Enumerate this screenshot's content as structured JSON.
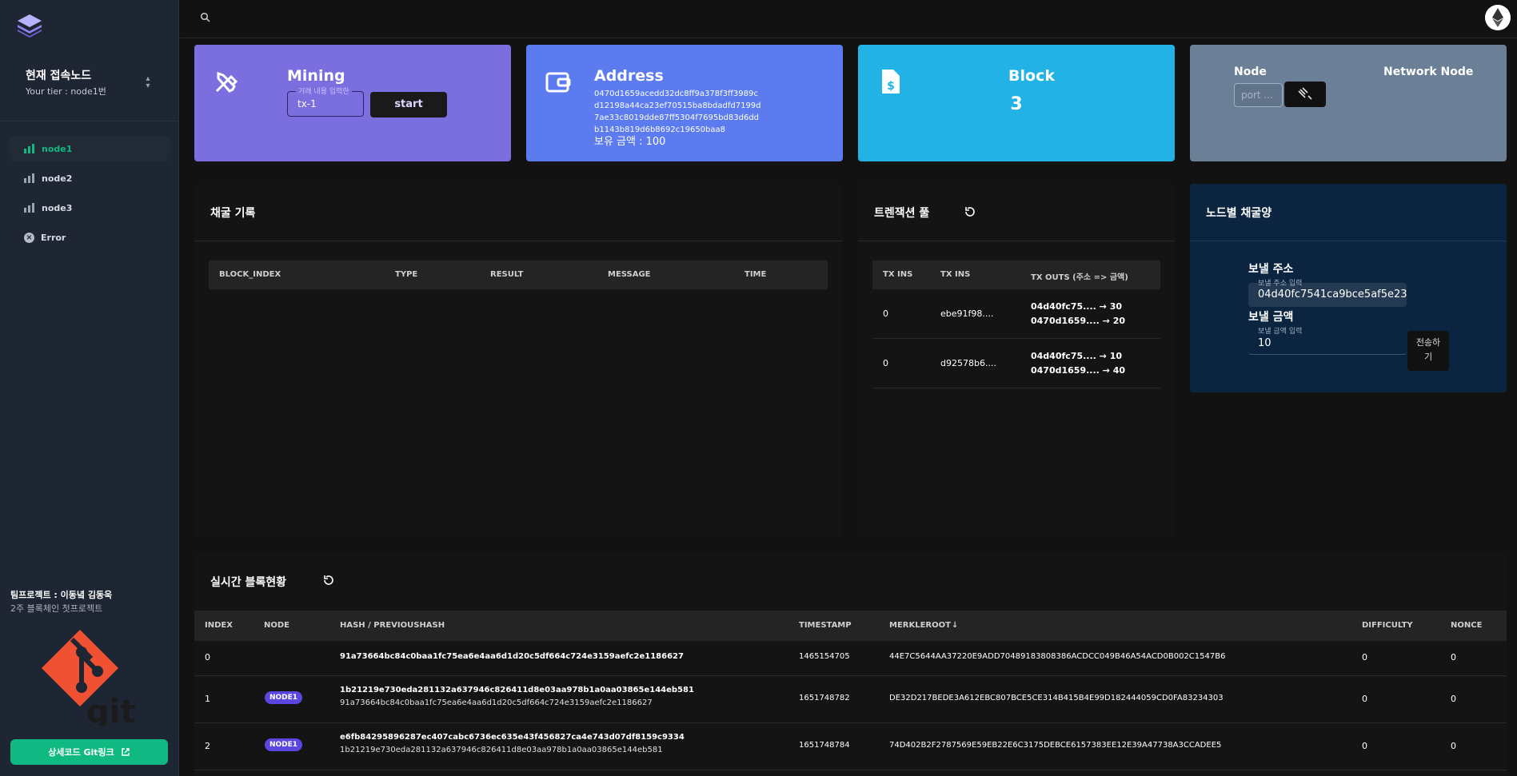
{
  "sidebar": {
    "node_switch": {
      "title": "현재 접속노드",
      "tier": "Your tier : node1번"
    },
    "nav": [
      {
        "label": "node1",
        "active": true
      },
      {
        "label": "node2",
        "active": false
      },
      {
        "label": "node3",
        "active": false
      },
      {
        "label": "Error",
        "active": false
      }
    ],
    "team": "팀프로젝트 : 이동녘 김동욱",
    "team_sub": "2주 블록체인 첫프로젝트",
    "git_button": "상세코드 Git링크",
    "git_logo_text": "git"
  },
  "cards": {
    "mining": {
      "title": "Mining",
      "input_label": "거래 내용 입력란",
      "input_value": "tx-1",
      "button": "start"
    },
    "address": {
      "title": "Address",
      "value": "0470d1659acedd32dc8ff9a378f3ff3989cd12198a44ca23ef70515ba8bdadfd7199d7ae33c8019dde87ff5304f7695bd83d6ddb1143b819d6b8692c19650baa8",
      "balance": "보유 금액 : 100"
    },
    "block": {
      "title": "Block",
      "value": "3"
    },
    "node": {
      "title": "Node",
      "network_title": "Network Node",
      "port_placeholder": "port ..."
    }
  },
  "mine_history": {
    "title": "채굴 기록",
    "columns": [
      "BLOCK_INDEX",
      "TYPE",
      "RESULT",
      "MESSAGE",
      "TIME"
    ]
  },
  "tx_pool": {
    "title": "트렌잭션 풀",
    "columns": [
      "TX INS",
      "TX INS",
      "TX OUTS (주소 => 금액)"
    ],
    "rows": [
      {
        "index": "0",
        "txin": "ebe91f98....",
        "out1": "04d40fc75.... → 30",
        "out2": "0470d1659.... → 20"
      },
      {
        "index": "0",
        "txin": "d92578b6....",
        "out1": "04d40fc75.... → 10",
        "out2": "0470d1659.... → 40"
      }
    ]
  },
  "send": {
    "title": "노드별 채굴양",
    "address_label": "보낼 주소",
    "address_field_label": "보낼 주소 입력",
    "address_value": "04d40fc7541ca9bce5af5e23",
    "amount_label": "보낼 금액",
    "amount_field_label": "보낼 금액 입력",
    "amount_value": "10",
    "button_line1": "전송하",
    "button_line2": "기"
  },
  "live_blocks": {
    "title": "실시간 블록현황",
    "columns": [
      "INDEX",
      "NODE",
      "HASH / PREVIOUSHASH",
      "TIMESTAMP",
      "MERKLEROOT",
      "DIFFICULTY",
      "NONCE"
    ],
    "rows": [
      {
        "index": "0",
        "node": "",
        "hash": "91a73664bc84c0baa1fc75ea6e4aa6d1d20c5df664c724e3159aefc2e1186627",
        "prev": "",
        "timestamp": "1465154705",
        "merkle": "44E7C5644AA37220E9ADD70489183808386ACDCC049B46A54ACD0B002C1547B6",
        "difficulty": "0",
        "nonce": "0"
      },
      {
        "index": "1",
        "node": "NODE1",
        "hash": "1b21219e730eda281132a637946c826411d8e03aa978b1a0aa03865e144eb581",
        "prev": "91a73664bc84c0baa1fc75ea6e4aa6d1d20c5df664c724e3159aefc2e1186627",
        "timestamp": "1651748782",
        "merkle": "DE32D217BEDE3A612EBC807BCE5CE314B415B4E99D182444059CD0FA83234303",
        "difficulty": "0",
        "nonce": "0"
      },
      {
        "index": "2",
        "node": "NODE1",
        "hash": "e6fb84295896287ec407cabc6736ec635e43f456827ca4e743d07df8159c9334",
        "prev": "1b21219e730eda281132a637946c826411d8e03aa978b1a0aa03865e144eb581",
        "timestamp": "1651748784",
        "merkle": "74D402B2F2787569E59EB22E6C3175DEBCE6157383EE12E39A47738A3CCADEE5",
        "difficulty": "0",
        "nonce": "0"
      }
    ]
  },
  "colors": {
    "accent": "#10b981",
    "mining": "#7b6fe0",
    "address": "#5b7bef",
    "block": "#22b2e6",
    "node": "#6b7f96",
    "badge": "#5b47e0"
  }
}
